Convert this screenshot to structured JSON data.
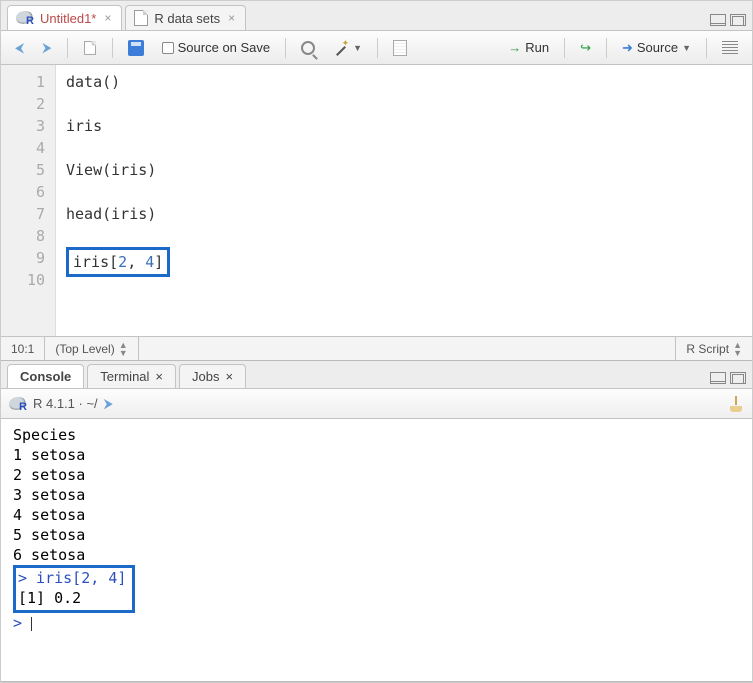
{
  "editor": {
    "tabs": [
      {
        "label": "Untitled1*",
        "dirty": true,
        "active": true,
        "icon": "r-logo"
      },
      {
        "label": "R data sets",
        "dirty": false,
        "active": false,
        "icon": "file"
      }
    ],
    "toolbar": {
      "source_on_save": "Source on Save",
      "run": "Run",
      "source": "Source"
    },
    "gutter": [
      "1",
      "2",
      "3",
      "4",
      "5",
      "6",
      "7",
      "8",
      "9",
      "10"
    ],
    "code_lines": [
      "data()",
      "",
      "iris",
      "",
      "View(iris)",
      "",
      "head(iris)",
      "",
      "iris[2, 4]",
      ""
    ],
    "highlight_line_index": 8,
    "status": {
      "pos": "10:1",
      "scope": "(Top Level)",
      "mode": "R Script"
    }
  },
  "console": {
    "tabs": [
      {
        "label": "Console",
        "active": true
      },
      {
        "label": "Terminal",
        "active": false
      },
      {
        "label": "Jobs",
        "active": false
      }
    ],
    "info": "R 4.1.1 · ~/",
    "lines": [
      "  Species",
      "1  setosa",
      "2  setosa",
      "3  setosa",
      "4  setosa",
      "5  setosa",
      "6  setosa"
    ],
    "boxed": {
      "prompt_line": "> iris[2, 4]",
      "result_line": "[1] 0.2"
    },
    "prompt": ">"
  }
}
